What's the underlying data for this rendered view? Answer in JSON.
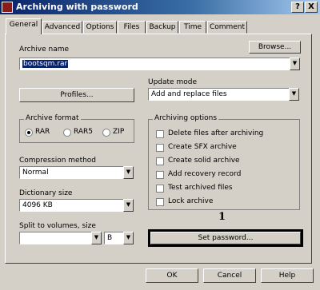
{
  "window": {
    "title": "Archiving with password",
    "help_glyph": "?",
    "close_glyph": "X"
  },
  "tabs": [
    "General",
    "Advanced",
    "Options",
    "Files",
    "Backup",
    "Time",
    "Comment"
  ],
  "archive_name": {
    "label": "Archive name",
    "value": "bootsqm.rar",
    "browse_label": "Browse..."
  },
  "profiles_label": "Profiles...",
  "update_mode": {
    "label": "Update mode",
    "value": "Add and replace files"
  },
  "archive_format": {
    "label": "Archive format",
    "options": [
      "RAR",
      "RAR5",
      "ZIP"
    ],
    "selected": "RAR"
  },
  "compression": {
    "label": "Compression method",
    "value": "Normal"
  },
  "dictionary": {
    "label": "Dictionary size",
    "value": "4096 KB"
  },
  "split": {
    "label": "Split to volumes, size",
    "value": "",
    "unit": "B"
  },
  "archiving_options": {
    "label": "Archiving options",
    "items": [
      {
        "label": "Delete files after archiving",
        "checked": false
      },
      {
        "label": "Create SFX archive",
        "checked": false
      },
      {
        "label": "Create solid archive",
        "checked": false
      },
      {
        "label": "Add recovery record",
        "checked": false
      },
      {
        "label": "Test archived files",
        "checked": false
      },
      {
        "label": "Lock archive",
        "checked": false
      }
    ]
  },
  "annotation_number": "1",
  "set_password_label": "Set password...",
  "buttons": {
    "ok": "OK",
    "cancel": "Cancel",
    "help": "Help"
  }
}
